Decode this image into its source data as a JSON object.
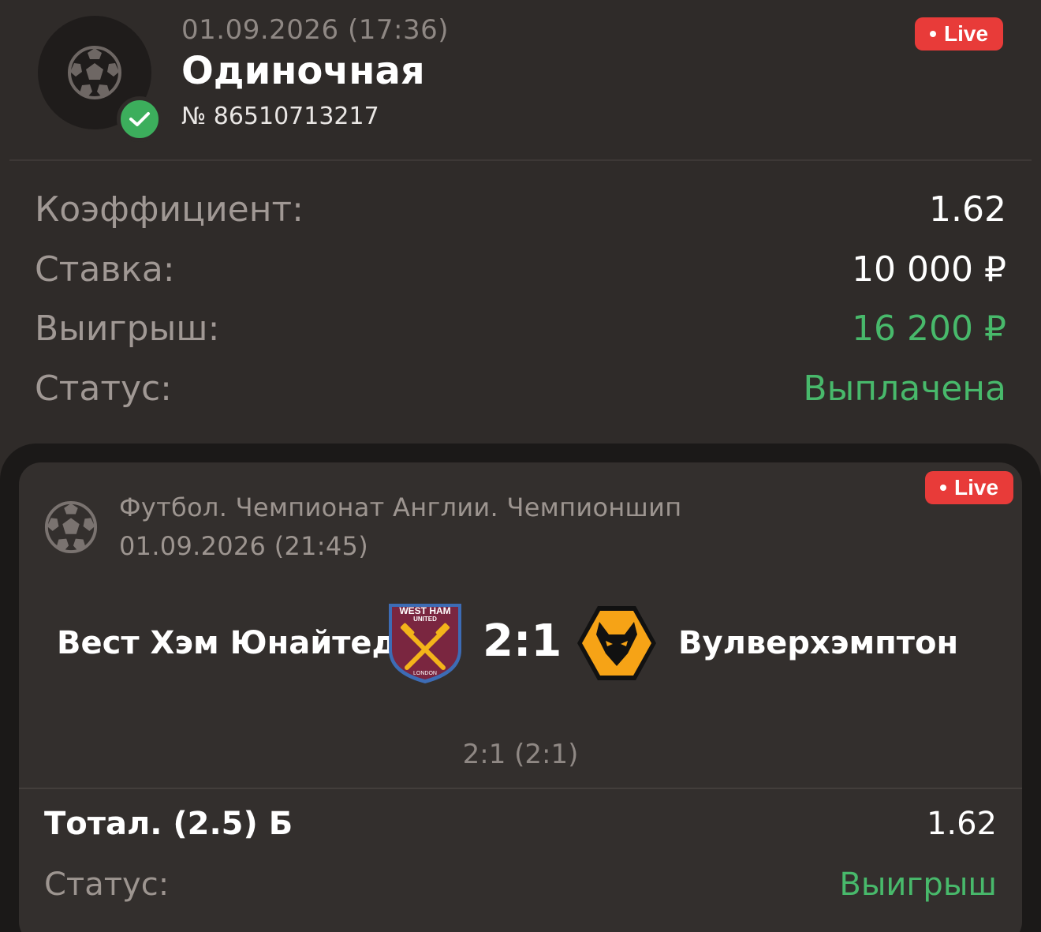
{
  "header": {
    "date": "01.09.2026 (17:36)",
    "bet_type": "Одиночная",
    "bet_number": "№ 86510713217",
    "live_badge": "Live"
  },
  "summary": {
    "coefficient_label": "Коэффициент:",
    "coefficient_value": "1.62",
    "stake_label": "Ставка:",
    "stake_value": "10 000 ₽",
    "win_label": "Выигрыш:",
    "win_value": "16 200 ₽",
    "status_label": "Статус:",
    "status_value": "Выплачена"
  },
  "event": {
    "league": "Футбол. Чемпионат Англии. Чемпионшип",
    "date": "01.09.2026 (21:45)",
    "live_badge": "Live",
    "home_team": "Вест Хэм Юнайтед",
    "away_team": "Вулверхэмптон",
    "score": "2:1",
    "score_detail": "2:1 (2:1)",
    "home_crest_text_top": "WEST HAM",
    "home_crest_text_mid": "UNITED",
    "home_crest_text_bottom": "LONDON",
    "market": "Тотал. (2.5) Б",
    "market_odds": "1.62",
    "status_label": "Статус:",
    "status_value": "Выигрыш"
  },
  "colors": {
    "background": "#2f2b29",
    "card": "#332f2d",
    "accent_green": "#48b96b",
    "live_red": "#e83b39",
    "muted_text": "#a09894"
  },
  "icons": {
    "sport": "football-icon",
    "settled": "check-icon"
  }
}
